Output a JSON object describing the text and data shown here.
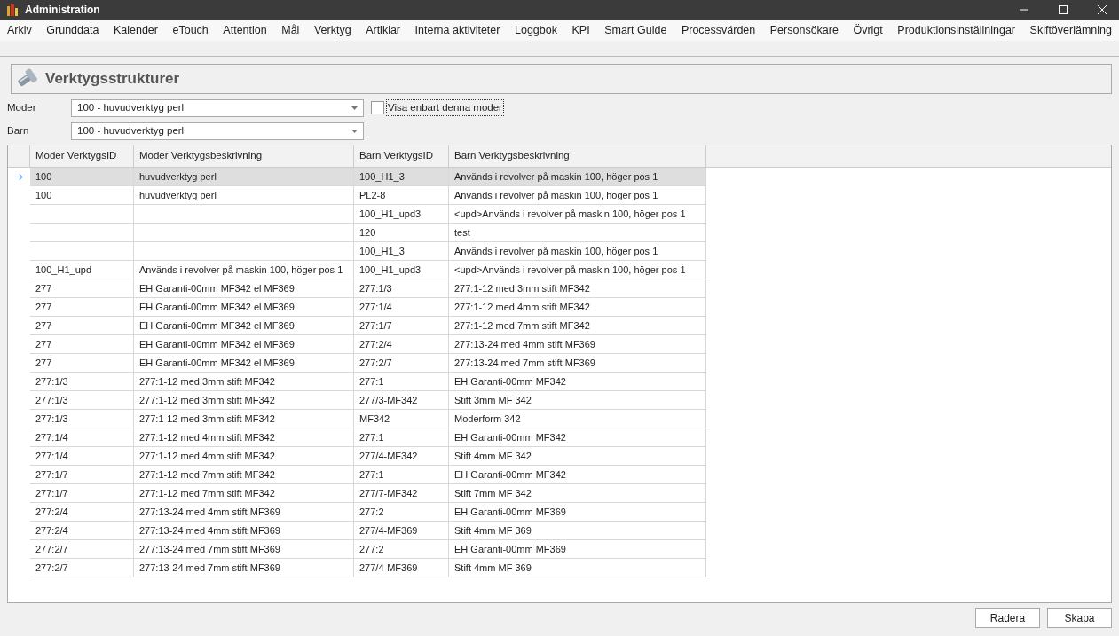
{
  "window": {
    "title": "Administration"
  },
  "menu": [
    "Arkiv",
    "Grunddata",
    "Kalender",
    "eTouch",
    "Attention",
    "Mål",
    "Verktyg",
    "Artiklar",
    "Interna aktiviteter",
    "Loggbok",
    "KPI",
    "Smart Guide",
    "Processvärden",
    "Personsökare",
    "Övrigt",
    "Produktionsinställningar",
    "Skiftöverlämning"
  ],
  "header": {
    "title": "Verktygsstrukturer"
  },
  "filters": [
    {
      "label": "Moder",
      "value": "100 - huvudverktyg perl"
    },
    {
      "label": "Barn",
      "value": "100 - huvudverktyg perl"
    }
  ],
  "only_this_parent": {
    "label": "Visa enbart denna moder",
    "checked": false
  },
  "table": {
    "columns": [
      "Moder VerktygsID",
      "Moder Verktygsbeskrivning",
      "Barn VerktygsID",
      "Barn Verktygsbeskrivning"
    ],
    "rows": [
      {
        "selected": true,
        "cells": [
          "100",
          "huvudverktyg perl",
          "100_H1_3",
          "Används i revolver på maskin 100, höger pos 1"
        ]
      },
      {
        "selected": false,
        "cells": [
          "100",
          "huvudverktyg perl",
          "PL2-8",
          "Används i revolver på maskin 100, höger pos 1"
        ]
      },
      {
        "selected": false,
        "cells": [
          "",
          "",
          "100_H1_upd3",
          "<upd>Används i revolver på maskin 100, höger pos 1"
        ]
      },
      {
        "selected": false,
        "cells": [
          "",
          "",
          "120",
          "test"
        ]
      },
      {
        "selected": false,
        "cells": [
          "",
          "",
          "100_H1_3",
          "Används i revolver på maskin 100, höger pos 1"
        ]
      },
      {
        "selected": false,
        "cells": [
          "100_H1_upd",
          "Används i revolver på maskin 100, höger pos 1",
          "100_H1_upd3",
          "<upd>Används i revolver på maskin 100, höger pos 1"
        ]
      },
      {
        "selected": false,
        "cells": [
          "277",
          "EH Garanti-00mm MF342 el MF369",
          "277:1/3",
          "277:1-12 med 3mm stift MF342"
        ]
      },
      {
        "selected": false,
        "cells": [
          "277",
          "EH Garanti-00mm MF342 el MF369",
          "277:1/4",
          "277:1-12 med 4mm stift MF342"
        ]
      },
      {
        "selected": false,
        "cells": [
          "277",
          "EH Garanti-00mm MF342 el MF369",
          "277:1/7",
          "277:1-12 med 7mm stift MF342"
        ]
      },
      {
        "selected": false,
        "cells": [
          "277",
          "EH Garanti-00mm MF342 el MF369",
          "277:2/4",
          "277:13-24 med 4mm stift MF369"
        ]
      },
      {
        "selected": false,
        "cells": [
          "277",
          "EH Garanti-00mm MF342 el MF369",
          "277:2/7",
          "277:13-24 med 7mm stift MF369"
        ]
      },
      {
        "selected": false,
        "cells": [
          "277:1/3",
          "277:1-12 med 3mm stift MF342",
          "277:1",
          "EH Garanti-00mm MF342"
        ]
      },
      {
        "selected": false,
        "cells": [
          "277:1/3",
          "277:1-12 med 3mm stift MF342",
          "277/3-MF342",
          "Stift 3mm MF 342"
        ]
      },
      {
        "selected": false,
        "cells": [
          "277:1/3",
          "277:1-12 med 3mm stift MF342",
          "MF342",
          "Moderform 342"
        ]
      },
      {
        "selected": false,
        "cells": [
          "277:1/4",
          "277:1-12 med 4mm stift MF342",
          "277:1",
          "EH Garanti-00mm MF342"
        ]
      },
      {
        "selected": false,
        "cells": [
          "277:1/4",
          "277:1-12 med 4mm stift MF342",
          "277/4-MF342",
          "Stift 4mm MF 342"
        ]
      },
      {
        "selected": false,
        "cells": [
          "277:1/7",
          "277:1-12 med 7mm stift MF342",
          "277:1",
          "EH Garanti-00mm MF342"
        ]
      },
      {
        "selected": false,
        "cells": [
          "277:1/7",
          "277:1-12 med 7mm stift MF342",
          "277/7-MF342",
          "Stift 7mm MF 342"
        ]
      },
      {
        "selected": false,
        "cells": [
          "277:2/4",
          "277:13-24 med 4mm stift MF369",
          "277:2",
          "EH Garanti-00mm MF369"
        ]
      },
      {
        "selected": false,
        "cells": [
          "277:2/4",
          "277:13-24 med 4mm stift MF369",
          "277/4-MF369",
          "Stift 4mm MF 369"
        ]
      },
      {
        "selected": false,
        "cells": [
          "277:2/7",
          "277:13-24 med 7mm stift MF369",
          "277:2",
          "EH Garanti-00mm MF369"
        ]
      },
      {
        "selected": false,
        "cells": [
          "277:2/7",
          "277:13-24 med 7mm stift MF369",
          "277/4-MF369",
          "Stift 4mm MF 369"
        ]
      }
    ]
  },
  "buttons": [
    "Radera",
    "Skapa"
  ]
}
